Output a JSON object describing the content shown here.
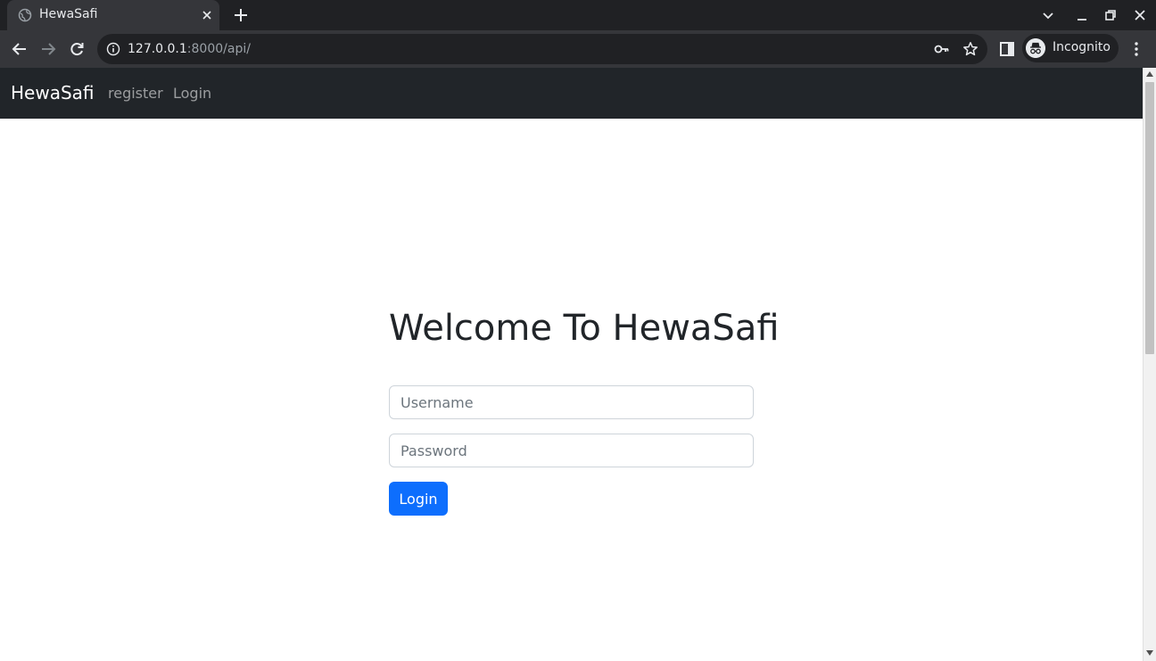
{
  "browser": {
    "tab": {
      "title": "HewaSafi",
      "favicon": "globe-icon"
    },
    "address": {
      "host": "127.0.0.1",
      "rest": ":8000/api/"
    },
    "profile_label": "Incognito"
  },
  "navbar": {
    "brand": "HewaSafi",
    "links": [
      "register",
      "Login"
    ]
  },
  "login": {
    "heading": "Welcome To HewaSafi",
    "username_placeholder": "Username",
    "password_placeholder": "Password",
    "submit_label": "Login"
  },
  "colors": {
    "navbar_bg": "#212529",
    "primary_button": "#0d6efd",
    "chrome_dark": "#202124",
    "chrome_toolbar": "#35363a"
  }
}
